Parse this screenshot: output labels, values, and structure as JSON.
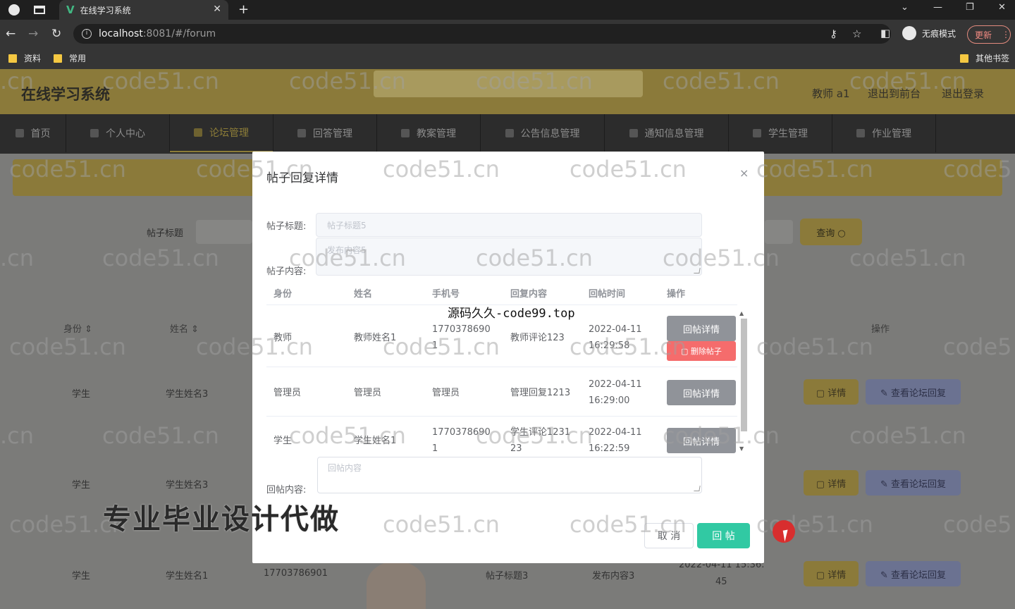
{
  "browser": {
    "tab_title": "在线学习系统",
    "url_host": "localhost",
    "url_path": ":8081/#/forum",
    "incognito_label": "无痕模式",
    "update_label": "更新",
    "bookmarks": [
      "资料",
      "常用"
    ],
    "other_bookmarks": "其他书签"
  },
  "app": {
    "title": "在线学习系统",
    "header_links": [
      "教师 a1",
      "退出到前台",
      "退出登录"
    ],
    "nav": [
      "首页",
      "个人中心",
      "论坛管理",
      "回答管理",
      "教案管理",
      "公告信息管理",
      "通知信息管理",
      "学生管理",
      "作业管理"
    ],
    "nav_active": "论坛管理",
    "filter_label": "帖子标题",
    "query_label": "查询 ○",
    "table_headers": {
      "identity": "身份 ⇕",
      "name": "姓名 ⇕",
      "action": "操作"
    },
    "rows": [
      {
        "identity": "学生",
        "name": "学生姓名3"
      },
      {
        "identity": "学生",
        "name": "学生姓名3"
      },
      {
        "identity": "学生",
        "name": "学生姓名1",
        "phone": "17703786901",
        "title": "帖子标题3",
        "content": "发布内容3",
        "time": "2022-04-11 15:36:",
        "time2": "45"
      }
    ],
    "detail_label": "▢ 详情",
    "view_reply_label": "✎ 查看论坛回复"
  },
  "modal": {
    "title": "帖子回复详情",
    "close": "×",
    "post_title_label": "帖子标题:",
    "post_title_placeholder": "帖子标题5",
    "post_content_label": "帖子内容:",
    "post_content_placeholder": "发布内容5",
    "columns": [
      "身份",
      "姓名",
      "手机号",
      "回复内容",
      "回帖时间",
      "操作"
    ],
    "replies": [
      {
        "identity": "教师",
        "name": "教师姓名1",
        "phone": "1770378690",
        "phone2": "1",
        "content": "教师评论123",
        "content2": "",
        "date": "2022-04-11",
        "time": "16:29:58"
      },
      {
        "identity": "管理员",
        "name": "管理员",
        "phone": "管理员",
        "phone2": "",
        "content": "管理回复1213",
        "content2": "",
        "date": "2022-04-11",
        "time": "16:29:00"
      },
      {
        "identity": "学生",
        "name": "学生姓名1",
        "phone": "1770378690",
        "phone2": "1",
        "content": "学生评论1231",
        "content2": "23",
        "date": "2022-04-11",
        "time": "16:22:59"
      }
    ],
    "reply_detail_label": "回帖详情",
    "delete_label": "▢ 删除帖子",
    "reply_content_label": "回帖内容:",
    "reply_content_placeholder": "回帖内容",
    "cancel_label": "取 消",
    "submit_label": "回 帖"
  },
  "overlays": {
    "source_text": "源码久久-code99.top",
    "promo_text": "专业毕业设计代做",
    "watermark": "code51.cn",
    "watermark_partial_left": ".cn",
    "watermark_partial_right": "code5"
  }
}
